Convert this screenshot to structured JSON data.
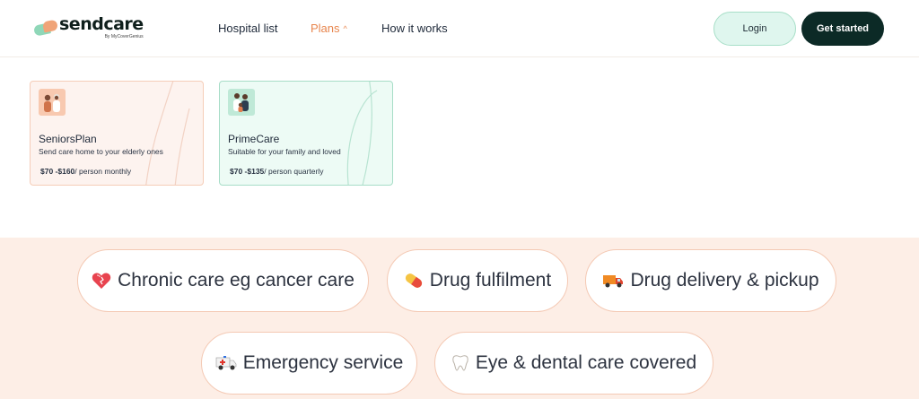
{
  "brand": {
    "name": "sendcare",
    "tagline": "By MyCoverGenius"
  },
  "nav": {
    "hospital_list": "Hospital list",
    "plans": "Plans",
    "how_it_works": "How it works"
  },
  "header": {
    "login_label": "Login",
    "get_started_label": "Get started"
  },
  "plans": [
    {
      "title": "SeniorsPlan",
      "description": "Send care home to your elderly ones",
      "price": "$70 -$160",
      "period": "/ person monthly"
    },
    {
      "title": "PrimeCare",
      "description": "Suitable for your family and loved",
      "price": "$70 -$135",
      "period": "/ person quarterly"
    }
  ],
  "features": [
    {
      "icon": "heart-icon",
      "label": "Chronic care eg cancer care"
    },
    {
      "icon": "pill-icon",
      "label": "Drug fulfilment"
    },
    {
      "icon": "delivery-truck-icon",
      "label": "Drug delivery & pickup"
    },
    {
      "icon": "ambulance-icon",
      "label": "Emergency service"
    },
    {
      "icon": "tooth-icon",
      "label": "Eye & dental care covered"
    }
  ],
  "colors": {
    "accent": "#e8864e",
    "dark_button": "#0c2a26",
    "login_button": "#dff6ee",
    "features_band": "#fdeee6"
  }
}
